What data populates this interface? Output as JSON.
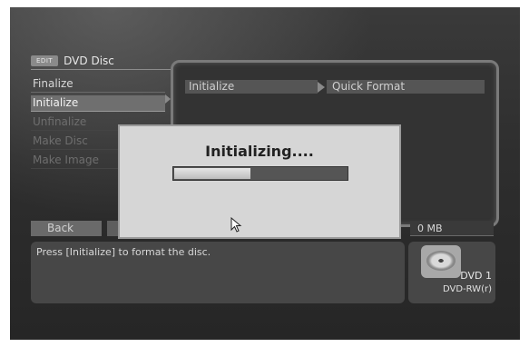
{
  "header": {
    "edit_label": "EDIT",
    "title": "DVD Disc"
  },
  "menu": {
    "items": [
      {
        "label": "Finalize",
        "state": "normal"
      },
      {
        "label": "Initialize",
        "state": "selected"
      },
      {
        "label": "Unfinalize",
        "state": "disabled"
      },
      {
        "label": "Make Disc",
        "state": "disabled"
      },
      {
        "label": "Make Image",
        "state": "disabled"
      }
    ]
  },
  "panel": {
    "crumb_primary": "Initialize",
    "crumb_secondary": "Quick Format"
  },
  "footer": {
    "back_label": "Back",
    "size_value": "0 MB",
    "message": "Press [Initialize] to format the disc."
  },
  "disc": {
    "label": "DVD 1",
    "type": "DVD-RW(r)",
    "icon": "dvd-disc-icon"
  },
  "dialog": {
    "title": "Initializing....",
    "progress_fraction": 0.44
  },
  "colors": {
    "background": "#2e2e2e",
    "selected_item": "#6f6f6f",
    "dialog": "#d6d6d6"
  }
}
